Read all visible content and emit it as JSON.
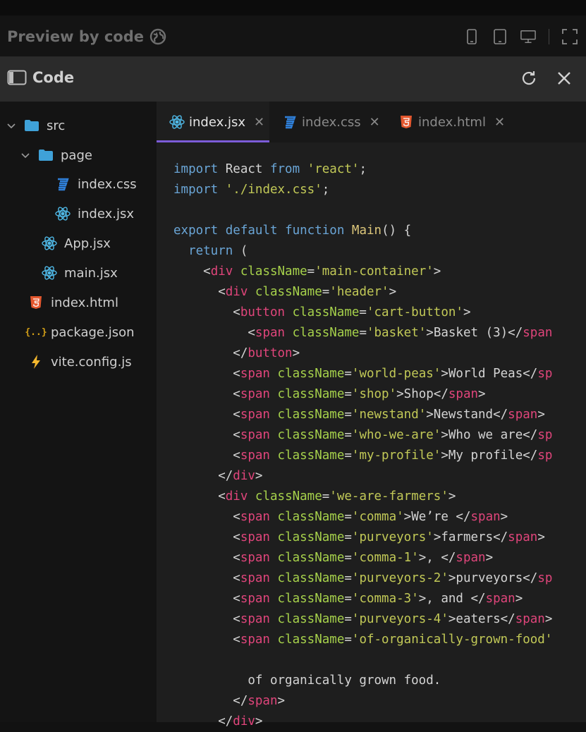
{
  "preview": {
    "title": "Preview by code"
  },
  "panel": {
    "title": "Code"
  },
  "tree": [
    {
      "label": "src",
      "type": "folder",
      "expanded": true
    },
    {
      "label": "page",
      "type": "folder",
      "expanded": true
    },
    {
      "label": "index.css",
      "type": "css"
    },
    {
      "label": "index.jsx",
      "type": "react"
    },
    {
      "label": "App.jsx",
      "type": "react"
    },
    {
      "label": "main.jsx",
      "type": "react"
    },
    {
      "label": "index.html",
      "type": "html"
    },
    {
      "label": "package.json",
      "type": "json"
    },
    {
      "label": "vite.config.js",
      "type": "vite"
    }
  ],
  "tabs": [
    {
      "label": "index.jsx",
      "type": "react",
      "active": true
    },
    {
      "label": "index.css",
      "type": "css",
      "active": false
    },
    {
      "label": "index.html",
      "type": "html",
      "active": false
    }
  ],
  "code_lines": [
    [
      [
        "kw",
        "import"
      ],
      [
        "pl",
        " React "
      ],
      [
        "kw",
        "from"
      ],
      [
        "pl",
        " "
      ],
      [
        "str",
        "'react'"
      ],
      [
        "pl",
        ";"
      ]
    ],
    [
      [
        "kw",
        "import"
      ],
      [
        "pl",
        " "
      ],
      [
        "str",
        "'./index.css'"
      ],
      [
        "pl",
        ";"
      ]
    ],
    [],
    [
      [
        "kw",
        "export"
      ],
      [
        "pl",
        " "
      ],
      [
        "kw",
        "default"
      ],
      [
        "pl",
        " "
      ],
      [
        "kw",
        "function"
      ],
      [
        "pl",
        " "
      ],
      [
        "fn",
        "Main"
      ],
      [
        "pl",
        "() {"
      ]
    ],
    [
      [
        "pl",
        "  "
      ],
      [
        "kw",
        "return"
      ],
      [
        "pl",
        " ("
      ]
    ],
    [
      [
        "pl",
        "    <"
      ],
      [
        "tag",
        "div"
      ],
      [
        "pl",
        " "
      ],
      [
        "attr",
        "className"
      ],
      [
        "pl",
        "="
      ],
      [
        "str",
        "'main-container'"
      ],
      [
        "pl",
        ">"
      ]
    ],
    [
      [
        "pl",
        "      <"
      ],
      [
        "tag",
        "div"
      ],
      [
        "pl",
        " "
      ],
      [
        "attr",
        "className"
      ],
      [
        "pl",
        "="
      ],
      [
        "str",
        "'header'"
      ],
      [
        "pl",
        ">"
      ]
    ],
    [
      [
        "pl",
        "        <"
      ],
      [
        "tag",
        "button"
      ],
      [
        "pl",
        " "
      ],
      [
        "attr",
        "className"
      ],
      [
        "pl",
        "="
      ],
      [
        "str",
        "'cart-button'"
      ],
      [
        "pl",
        ">"
      ]
    ],
    [
      [
        "pl",
        "          <"
      ],
      [
        "tag",
        "span"
      ],
      [
        "pl",
        " "
      ],
      [
        "attr",
        "className"
      ],
      [
        "pl",
        "="
      ],
      [
        "str",
        "'basket'"
      ],
      [
        "pl",
        ">Basket (3)</"
      ],
      [
        "tag",
        "span"
      ]
    ],
    [
      [
        "pl",
        "        </"
      ],
      [
        "tag",
        "button"
      ],
      [
        "pl",
        ">"
      ]
    ],
    [
      [
        "pl",
        "        <"
      ],
      [
        "tag",
        "span"
      ],
      [
        "pl",
        " "
      ],
      [
        "attr",
        "className"
      ],
      [
        "pl",
        "="
      ],
      [
        "str",
        "'world-peas'"
      ],
      [
        "pl",
        ">World Peas</"
      ],
      [
        "tag",
        "sp"
      ]
    ],
    [
      [
        "pl",
        "        <"
      ],
      [
        "tag",
        "span"
      ],
      [
        "pl",
        " "
      ],
      [
        "attr",
        "className"
      ],
      [
        "pl",
        "="
      ],
      [
        "str",
        "'shop'"
      ],
      [
        "pl",
        ">Shop</"
      ],
      [
        "tag",
        "span"
      ],
      [
        "pl",
        ">"
      ]
    ],
    [
      [
        "pl",
        "        <"
      ],
      [
        "tag",
        "span"
      ],
      [
        "pl",
        " "
      ],
      [
        "attr",
        "className"
      ],
      [
        "pl",
        "="
      ],
      [
        "str",
        "'newstand'"
      ],
      [
        "pl",
        ">Newstand</"
      ],
      [
        "tag",
        "span"
      ],
      [
        "pl",
        "> "
      ]
    ],
    [
      [
        "pl",
        "        <"
      ],
      [
        "tag",
        "span"
      ],
      [
        "pl",
        " "
      ],
      [
        "attr",
        "className"
      ],
      [
        "pl",
        "="
      ],
      [
        "str",
        "'who-we-are'"
      ],
      [
        "pl",
        ">Who we are</"
      ],
      [
        "tag",
        "sp"
      ]
    ],
    [
      [
        "pl",
        "        <"
      ],
      [
        "tag",
        "span"
      ],
      [
        "pl",
        " "
      ],
      [
        "attr",
        "className"
      ],
      [
        "pl",
        "="
      ],
      [
        "str",
        "'my-profile'"
      ],
      [
        "pl",
        ">My profile</"
      ],
      [
        "tag",
        "sp"
      ]
    ],
    [
      [
        "pl",
        "      </"
      ],
      [
        "tag",
        "div"
      ],
      [
        "pl",
        ">"
      ]
    ],
    [
      [
        "pl",
        "      <"
      ],
      [
        "tag",
        "div"
      ],
      [
        "pl",
        " "
      ],
      [
        "attr",
        "className"
      ],
      [
        "pl",
        "="
      ],
      [
        "str",
        "'we-are-farmers'"
      ],
      [
        "pl",
        ">"
      ]
    ],
    [
      [
        "pl",
        "        <"
      ],
      [
        "tag",
        "span"
      ],
      [
        "pl",
        " "
      ],
      [
        "attr",
        "className"
      ],
      [
        "pl",
        "="
      ],
      [
        "str",
        "'comma'"
      ],
      [
        "pl",
        ">We’re </"
      ],
      [
        "tag",
        "span"
      ],
      [
        "pl",
        ">"
      ]
    ],
    [
      [
        "pl",
        "        <"
      ],
      [
        "tag",
        "span"
      ],
      [
        "pl",
        " "
      ],
      [
        "attr",
        "className"
      ],
      [
        "pl",
        "="
      ],
      [
        "str",
        "'purveyors'"
      ],
      [
        "pl",
        ">farmers</"
      ],
      [
        "tag",
        "span"
      ],
      [
        "pl",
        "> "
      ]
    ],
    [
      [
        "pl",
        "        <"
      ],
      [
        "tag",
        "span"
      ],
      [
        "pl",
        " "
      ],
      [
        "attr",
        "className"
      ],
      [
        "pl",
        "="
      ],
      [
        "str",
        "'comma-1'"
      ],
      [
        "pl",
        ">, </"
      ],
      [
        "tag",
        "span"
      ],
      [
        "pl",
        ">"
      ]
    ],
    [
      [
        "pl",
        "        <"
      ],
      [
        "tag",
        "span"
      ],
      [
        "pl",
        " "
      ],
      [
        "attr",
        "className"
      ],
      [
        "pl",
        "="
      ],
      [
        "str",
        "'purveyors-2'"
      ],
      [
        "pl",
        ">purveyors</"
      ],
      [
        "tag",
        "sp"
      ]
    ],
    [
      [
        "pl",
        "        <"
      ],
      [
        "tag",
        "span"
      ],
      [
        "pl",
        " "
      ],
      [
        "attr",
        "className"
      ],
      [
        "pl",
        "="
      ],
      [
        "str",
        "'comma-3'"
      ],
      [
        "pl",
        ">, and </"
      ],
      [
        "tag",
        "span"
      ],
      [
        "pl",
        ">"
      ]
    ],
    [
      [
        "pl",
        "        <"
      ],
      [
        "tag",
        "span"
      ],
      [
        "pl",
        " "
      ],
      [
        "attr",
        "className"
      ],
      [
        "pl",
        "="
      ],
      [
        "str",
        "'purveyors-4'"
      ],
      [
        "pl",
        ">eaters</"
      ],
      [
        "tag",
        "span"
      ],
      [
        "pl",
        ">"
      ]
    ],
    [
      [
        "pl",
        "        <"
      ],
      [
        "tag",
        "span"
      ],
      [
        "pl",
        " "
      ],
      [
        "attr",
        "className"
      ],
      [
        "pl",
        "="
      ],
      [
        "str",
        "'of-organically-grown-food'"
      ]
    ],
    [],
    [
      [
        "pl",
        "          of organically grown food."
      ]
    ],
    [
      [
        "pl",
        "        </"
      ],
      [
        "tag",
        "span"
      ],
      [
        "pl",
        ">"
      ]
    ],
    [
      [
        "pl",
        "      </"
      ],
      [
        "tag",
        "div"
      ],
      [
        "pl",
        ">"
      ]
    ]
  ],
  "colors": {
    "accent": "#7c5cd8",
    "keyword": "#6aa5d6",
    "string": "#c2c957",
    "tag": "#e0457b",
    "attribute": "#a6d14b",
    "function": "#dcc67a",
    "react_icon": "#4fb8e6",
    "folder_icon": "#3fa1d8",
    "html_icon": "#e4572e",
    "css_icon": "#2f7fd8",
    "json_icon": "#d4a017",
    "vite_icon": "#f5b82e"
  }
}
